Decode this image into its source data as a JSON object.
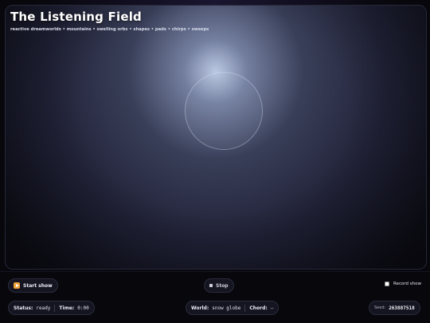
{
  "header": {
    "title": "The Listening Field",
    "subtitle": "reactive dreamworlds • mountains • swelling orbs • shapes • pads • chirps • sweeps"
  },
  "controls": {
    "start_label": "Start show",
    "stop_label": "Stop",
    "record_label": "Record show",
    "record_checked": false
  },
  "status_bar": {
    "status_label": "Status:",
    "status_value": "ready",
    "time_label": "Time:",
    "time_value": "0:00",
    "world_label": "World:",
    "world_value": "snow globe",
    "chord_label": "Chord:",
    "chord_value": "—",
    "seed_label": "Seed:",
    "seed_value": "263887518"
  },
  "colors": {
    "accent": "#f0a23a",
    "background": "#07070c",
    "glow": "#c4d2ee"
  },
  "icons": {
    "start": "play-icon",
    "stop": "stop-icon"
  }
}
